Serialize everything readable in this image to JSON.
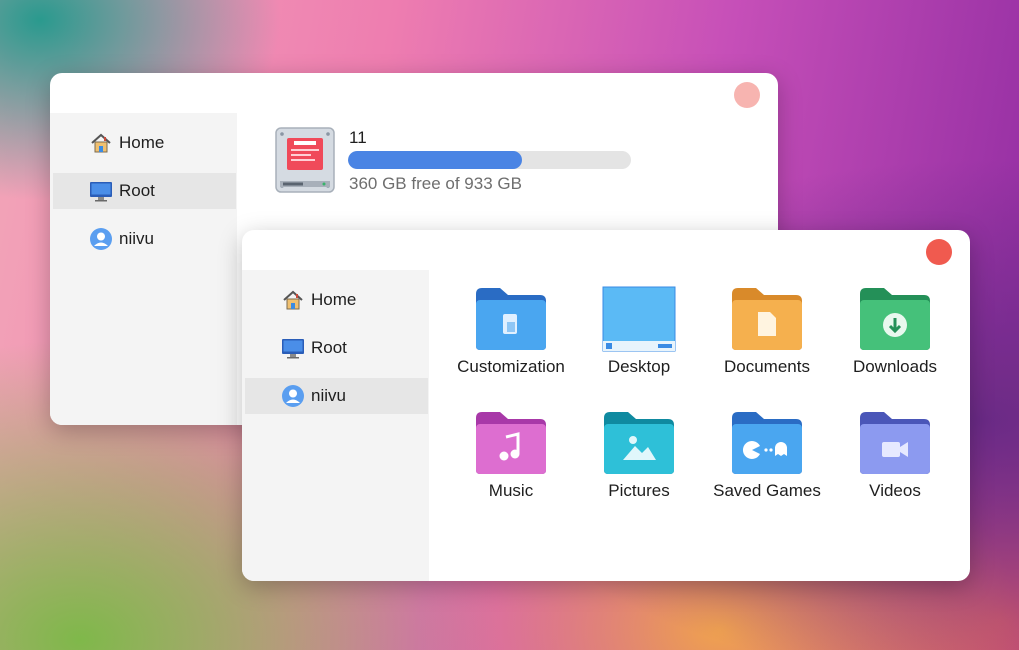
{
  "back_window": {
    "sidebar": [
      {
        "label": "Home",
        "icon": "home-icon"
      },
      {
        "label": "Root",
        "icon": "monitor-icon"
      },
      {
        "label": "niivu",
        "icon": "user-icon"
      }
    ],
    "active_item": "Root",
    "drive": {
      "name": "11",
      "free_text": "360 GB free of 933 GB",
      "used_fraction": 0.614
    },
    "close_color": "#f7b4b0"
  },
  "front_window": {
    "sidebar": [
      {
        "label": "Home",
        "icon": "home-icon"
      },
      {
        "label": "Root",
        "icon": "monitor-icon"
      },
      {
        "label": "niivu",
        "icon": "user-icon"
      }
    ],
    "active_item": "niivu",
    "folders": [
      {
        "label": "Customization",
        "icon": "customization-folder-icon",
        "color": "#3a8be4"
      },
      {
        "label": "Desktop",
        "icon": "desktop-icon",
        "color": "#5bbaf5"
      },
      {
        "label": "Documents",
        "icon": "documents-folder-icon",
        "color": "#f2a94b"
      },
      {
        "label": "Downloads",
        "icon": "downloads-folder-icon",
        "color": "#38b36a"
      },
      {
        "label": "Music",
        "icon": "music-folder-icon",
        "color": "#d45fc4"
      },
      {
        "label": "Pictures",
        "icon": "pictures-folder-icon",
        "color": "#1ea9c2"
      },
      {
        "label": "Saved Games",
        "icon": "saved-games-folder-icon",
        "color": "#3a8be4"
      },
      {
        "label": "Videos",
        "icon": "videos-folder-icon",
        "color": "#7a86e8"
      }
    ],
    "close_color": "#f05a4f"
  },
  "colors": {
    "sidebar_bg": "#f4f4f4",
    "active_bg": "#e6e6e6",
    "progress_fill": "#4a84e4"
  }
}
